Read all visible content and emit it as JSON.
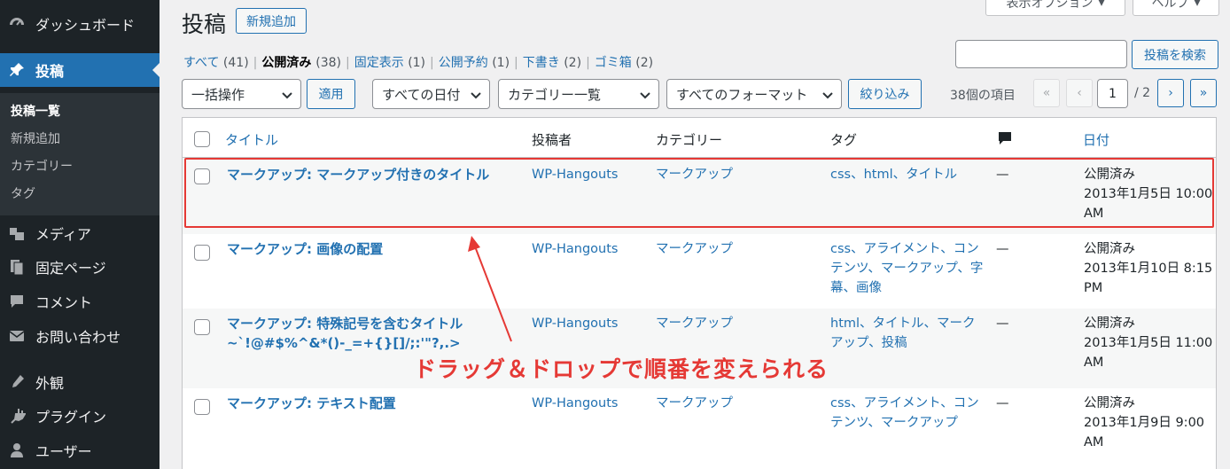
{
  "sidebar": {
    "items": [
      {
        "label": "ダッシュボード",
        "icon": "dashboard-icon"
      },
      {
        "label": "投稿",
        "icon": "pushpin-icon"
      },
      {
        "label": "メディア",
        "icon": "media-icon"
      },
      {
        "label": "固定ページ",
        "icon": "pages-icon"
      },
      {
        "label": "コメント",
        "icon": "comment-icon"
      },
      {
        "label": "お問い合わせ",
        "icon": "mail-icon"
      },
      {
        "label": "外観",
        "icon": "appearance-icon"
      },
      {
        "label": "プラグイン",
        "icon": "plugin-icon"
      },
      {
        "label": "ユーザー",
        "icon": "user-icon"
      }
    ],
    "submenu": [
      "投稿一覧",
      "新規追加",
      "カテゴリー",
      "タグ"
    ]
  },
  "header": {
    "title": "投稿",
    "add_new": "新規追加",
    "screen_options": "表示オプション",
    "help": "ヘルプ"
  },
  "views": [
    {
      "label": "すべて",
      "count": "(41)"
    },
    {
      "label": "公開済み",
      "count": "(38)"
    },
    {
      "label": "固定表示",
      "count": "(1)"
    },
    {
      "label": "公開予約",
      "count": "(1)"
    },
    {
      "label": "下書き",
      "count": "(2)"
    },
    {
      "label": "ゴミ箱",
      "count": "(2)"
    }
  ],
  "search": {
    "button": "投稿を検索",
    "value": ""
  },
  "filters": {
    "bulk_action": "一括操作",
    "apply": "適用",
    "dates": "すべての日付",
    "categories": "カテゴリー一覧",
    "formats": "すべてのフォーマット",
    "filter": "絞り込み"
  },
  "pagination": {
    "items": "38個の項目",
    "first": "«",
    "prev": "‹",
    "current": "1",
    "total": "/ 2",
    "next": "›",
    "last": "»"
  },
  "table": {
    "headers": {
      "title": "タイトル",
      "author": "投稿者",
      "category": "カテゴリー",
      "tags": "タグ",
      "comments_icon": "comment-bubble-icon",
      "date": "日付"
    },
    "rows": [
      {
        "title": "マークアップ: マークアップ付きのタイトル",
        "author": "WP-Hangouts",
        "category": "マークアップ",
        "tags": "css、html、タイトル",
        "comments": "—",
        "status": "公開済み",
        "date": "2013年1月5日 10:00",
        "time": "AM"
      },
      {
        "title": "マークアップ: 画像の配置",
        "author": "WP-Hangouts",
        "category": "マークアップ",
        "tags": "css、アライメント、コン",
        "tags2": "テンツ、マークアップ、字",
        "tags3": "幕、画像",
        "comments": "—",
        "status": "公開済み",
        "date": "2013年1月10日 8:15",
        "time": "PM"
      },
      {
        "title": "マークアップ: 特殊記号を含むタイトル",
        "title2": "~`!@#$%^&*()-_=+{}[]/;:'\"?,.>",
        "author": "WP-Hangouts",
        "category": "マークアップ",
        "tags": "html、タイトル、マーク",
        "tags2": "アップ、投稿",
        "comments": "—",
        "status": "公開済み",
        "date": "2013年1月5日 11:00",
        "time": "AM"
      },
      {
        "title": "マークアップ: テキスト配置",
        "author": "WP-Hangouts",
        "category": "マークアップ",
        "tags": "css、アライメント、コン",
        "tags2": "テンツ、マークアップ",
        "comments": "—",
        "status": "公開済み",
        "date": "2013年1月9日 9:00",
        "time": "AM"
      }
    ]
  },
  "annotation": {
    "text": "ドラッグ＆ドロップで順番を変えられる",
    "color": "#e53935"
  }
}
